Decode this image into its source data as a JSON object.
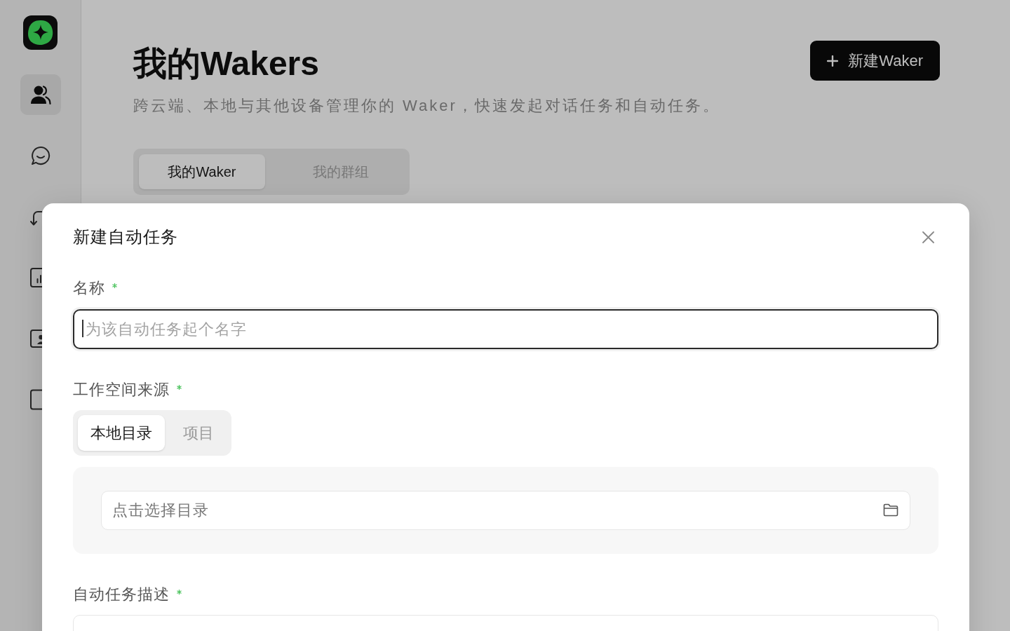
{
  "sidebar": {
    "items": [
      {
        "selected": true
      },
      {
        "selected": false
      },
      {
        "selected": false
      },
      {
        "selected": false
      },
      {
        "selected": false
      },
      {
        "selected": false
      }
    ]
  },
  "header": {
    "title": "我的Wakers",
    "subtitle": "跨云端、本地与其他设备管理你的 Waker，快速发起对话任务和自动任务。",
    "new_button": "新建Waker"
  },
  "tabs": [
    {
      "label": "我的Waker",
      "selected": true
    },
    {
      "label": "我的群组",
      "selected": false
    }
  ],
  "dialog": {
    "title": "新建自动任务",
    "fields": [
      {
        "kind": "text",
        "label": "名称",
        "required": true,
        "placeholder": "为该自动任务起个名字",
        "focused": true
      },
      {
        "kind": "workspace",
        "label": "工作空间来源",
        "required": true,
        "options": [
          {
            "label": "本地目录",
            "selected": true
          },
          {
            "label": "项目",
            "selected": false
          }
        ],
        "picker": {
          "placeholder": "点击选择目录"
        }
      },
      {
        "kind": "textarea",
        "label": "自动任务描述",
        "required": true
      }
    ]
  }
}
